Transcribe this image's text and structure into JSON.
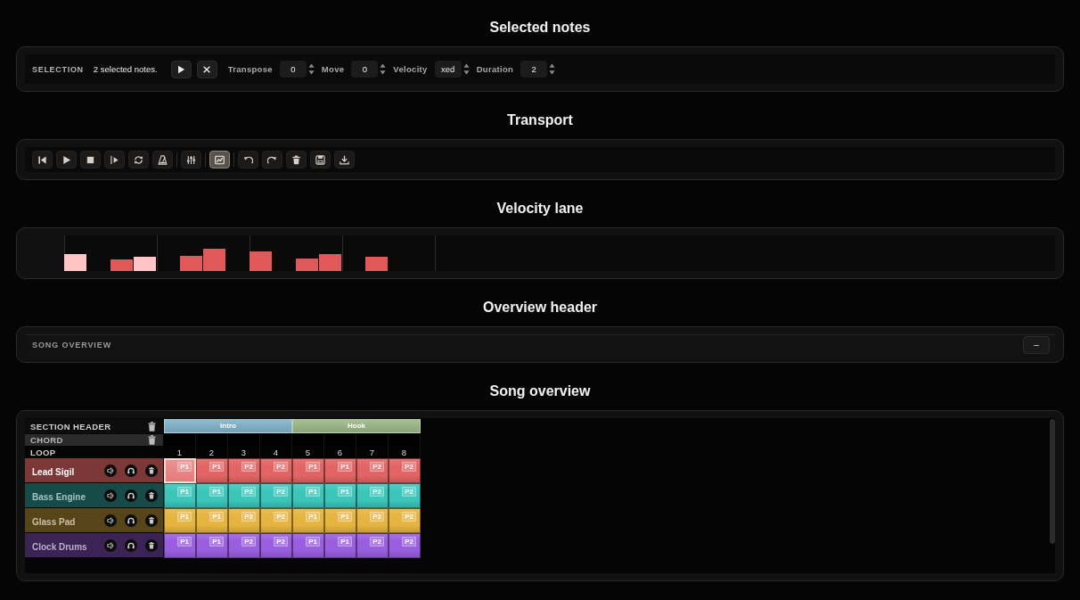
{
  "selection": {
    "title": "Selected notes",
    "label": "SELECTION",
    "summary": "2 selected notes.",
    "buttons": [
      {
        "kind": "play"
      },
      {
        "kind": "clear"
      }
    ],
    "fields": [
      {
        "label": "Transpose",
        "value": "0"
      },
      {
        "label": "Move",
        "value": "0"
      },
      {
        "label": "Velocity",
        "value": "xed"
      },
      {
        "label": "Duration",
        "value": "2"
      }
    ]
  },
  "transport": {
    "title": "Transport",
    "groups": [
      {
        "buttons": [
          {
            "kind": "skip-start",
            "on": false
          },
          {
            "kind": "play",
            "on": false
          },
          {
            "kind": "stop",
            "on": false
          },
          {
            "kind": "step",
            "on": false
          },
          {
            "kind": "loop",
            "on": false
          },
          {
            "kind": "metronome",
            "on": false
          }
        ]
      },
      {
        "buttons": [
          {
            "kind": "mixer",
            "on": false
          }
        ]
      },
      {
        "buttons": [
          {
            "kind": "chart",
            "on": true
          }
        ]
      },
      {
        "buttons": [
          {
            "kind": "undo",
            "on": false
          },
          {
            "kind": "redo",
            "on": false
          },
          {
            "kind": "delete",
            "on": false
          },
          {
            "kind": "save",
            "on": false
          },
          {
            "kind": "export",
            "on": false
          }
        ]
      }
    ]
  },
  "velocity_lane": {
    "title": "Velocity lane",
    "steps": [
      {
        "kind": "note",
        "level": 0.48,
        "selected": true
      },
      {
        "kind": "rest"
      },
      {
        "kind": "note",
        "level": 0.33,
        "selected": false
      },
      {
        "kind": "note",
        "level": 0.4,
        "selected": true
      },
      {
        "kind": "rest"
      },
      {
        "kind": "note",
        "level": 0.43,
        "selected": false
      },
      {
        "kind": "note",
        "level": 0.63,
        "selected": false
      },
      {
        "kind": "rest"
      },
      {
        "kind": "note",
        "level": 0.55,
        "selected": false
      },
      {
        "kind": "rest"
      },
      {
        "kind": "note",
        "level": 0.35,
        "selected": false
      },
      {
        "kind": "note",
        "level": 0.48,
        "selected": false
      },
      {
        "kind": "rest"
      },
      {
        "kind": "note",
        "level": 0.4,
        "selected": false
      },
      {
        "kind": "rest"
      },
      {
        "kind": "rest"
      }
    ]
  },
  "overview_header": {
    "title": "Overview header",
    "label": "SONG OVERVIEW",
    "collapse_button": "–"
  },
  "song_overview": {
    "title": "Song overview",
    "section_label": "SECTION HEADER",
    "chord_label": "CHORD",
    "loop_label": "LOOP",
    "sections": [
      {
        "name": "Intro",
        "color": "#7fb2ca"
      },
      {
        "name": "Hook",
        "color": "#9ab685"
      }
    ],
    "loops": [
      "1",
      "2",
      "3",
      "4",
      "5",
      "6",
      "7",
      "8"
    ],
    "tracks": [
      {
        "name": "Lead Sigil",
        "color": "#e26464",
        "selected": true,
        "clips": [
          {
            "pattern": "P1",
            "selected": true
          },
          {
            "pattern": "P1",
            "selected": false
          },
          {
            "pattern": "P2",
            "selected": false
          },
          {
            "pattern": "P2",
            "selected": false
          },
          {
            "pattern": "P1",
            "selected": false
          },
          {
            "pattern": "P1",
            "selected": false
          },
          {
            "pattern": "P2",
            "selected": false
          },
          {
            "pattern": "P2",
            "selected": false
          }
        ]
      },
      {
        "name": "Bass Engine",
        "color": "#3cc6ba",
        "selected": false,
        "clips": [
          {
            "pattern": "P1",
            "selected": false
          },
          {
            "pattern": "P1",
            "selected": false
          },
          {
            "pattern": "P2",
            "selected": false
          },
          {
            "pattern": "P2",
            "selected": false
          },
          {
            "pattern": "P1",
            "selected": false
          },
          {
            "pattern": "P1",
            "selected": false
          },
          {
            "pattern": "P2",
            "selected": false
          },
          {
            "pattern": "P2",
            "selected": false
          }
        ]
      },
      {
        "name": "Glass Pad",
        "color": "#e6b440",
        "selected": false,
        "clips": [
          {
            "pattern": "P1",
            "selected": false
          },
          {
            "pattern": "P1",
            "selected": false
          },
          {
            "pattern": "P2",
            "selected": false
          },
          {
            "pattern": "P2",
            "selected": false
          },
          {
            "pattern": "P1",
            "selected": false
          },
          {
            "pattern": "P1",
            "selected": false
          },
          {
            "pattern": "P2",
            "selected": false
          },
          {
            "pattern": "P2",
            "selected": false
          }
        ]
      },
      {
        "name": "Clock Drums",
        "color": "#9a5ee0",
        "selected": false,
        "clips": [
          {
            "pattern": "P1",
            "selected": false
          },
          {
            "pattern": "P1",
            "selected": false
          },
          {
            "pattern": "P2",
            "selected": false
          },
          {
            "pattern": "P2",
            "selected": false
          },
          {
            "pattern": "P1",
            "selected": false
          },
          {
            "pattern": "P1",
            "selected": false
          },
          {
            "pattern": "P2",
            "selected": false
          },
          {
            "pattern": "P2",
            "selected": false
          }
        ]
      }
    ]
  }
}
